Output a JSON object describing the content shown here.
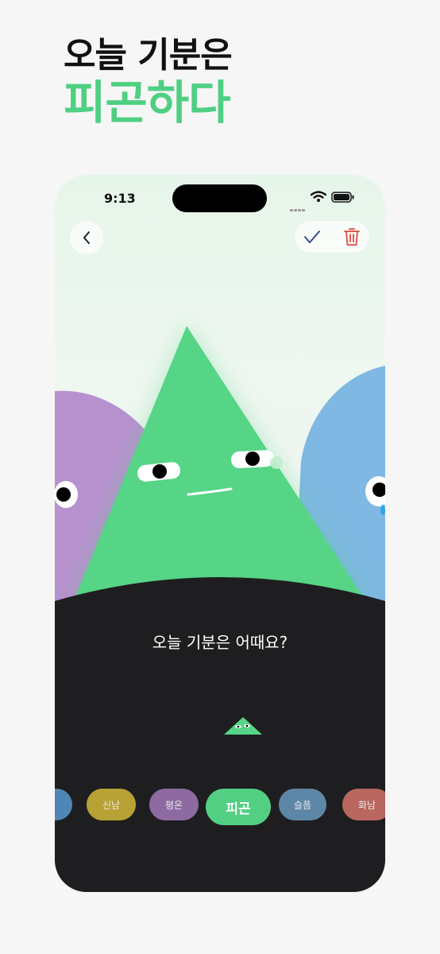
{
  "headline": {
    "line1": "오늘 기분은",
    "line2": "피곤하다"
  },
  "status_bar": {
    "time": "9:13"
  },
  "prompt": {
    "question": "오늘 기분은 어때요?"
  },
  "icons": {
    "back": "chevron-left-icon",
    "confirm": "check-icon",
    "delete": "trash-icon"
  },
  "moods": [
    {
      "label": "",
      "color": "#4e86b5"
    },
    {
      "label": "신남",
      "color": "#b8a235"
    },
    {
      "label": "평온",
      "color": "#8e6aa2"
    },
    {
      "label": "피곤",
      "color": "#52cf82",
      "selected": true
    },
    {
      "label": "슬픔",
      "color": "#5e87a7"
    },
    {
      "label": "화남",
      "color": "#b9675f"
    }
  ],
  "colors": {
    "accent": "#4fcf82",
    "panel": "#1e1e20",
    "purple": "#b791ce",
    "blue": "#7fb8e2",
    "danger": "#e45b52"
  }
}
